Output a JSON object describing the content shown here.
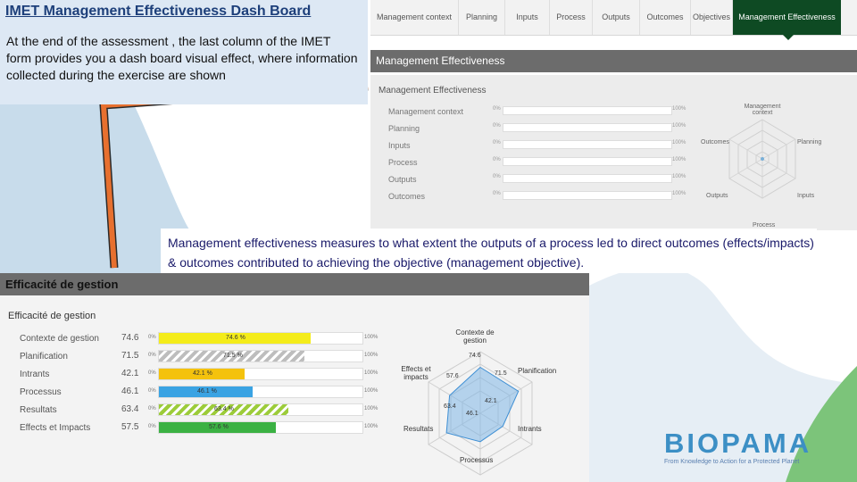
{
  "slide": {
    "title": "IMET Management Effectiveness Dash Board",
    "description": "At the end of the assessment , the last column of the IMET form provides you a dash board visual effect, where information collected during the exercise are shown",
    "definition": "Management effectiveness measures to what extent the outputs of a process led to direct outcomes (effects/impacts) & outcomes contributed to achieving the objective (management objective).",
    "colors": {
      "title_box": "#dde8f4",
      "arrow": "#e7702f",
      "active_tab": "#0e4a23"
    }
  },
  "en_panel": {
    "tabs": [
      "Management context",
      "Planning",
      "Inputs",
      "Process",
      "Outputs",
      "Outcomes",
      "Objectives",
      "Management Effectiveness"
    ],
    "active_tab": "Management Effectiveness",
    "header": "Management Effectiveness",
    "subheader": "Management Effectiveness",
    "rows": [
      "Management context",
      "Planning",
      "Inputs",
      "Process",
      "Outputs",
      "Outcomes"
    ],
    "zero_label": "0%",
    "hundred_label": "100%",
    "radar_labels": {
      "top": "Management context",
      "right_top": "Planning",
      "right_bottom": "Inputs",
      "bottom": "Process",
      "left_bottom": "Outputs",
      "left_top": "Outcomes"
    }
  },
  "fr_panel": {
    "header": "Efficacité de gestion",
    "subheader": "Efficacité de gestion",
    "zero_label": "0%",
    "hundred_label": "100%",
    "rows": [
      {
        "label": "Contexte de gestion",
        "value": "74.6",
        "pct": "74.6 %",
        "ratio": 0.746,
        "color": "#f4ec1a",
        "striped": false
      },
      {
        "label": "Planification",
        "value": "71.5",
        "pct": "71.5 %",
        "ratio": 0.715,
        "color": "#bdbdbd",
        "striped": true
      },
      {
        "label": "Intrants",
        "value": "42.1",
        "pct": "42.1 %",
        "ratio": 0.421,
        "color": "#f4c20d",
        "striped": false
      },
      {
        "label": "Processus",
        "value": "46.1",
        "pct": "46.1 %",
        "ratio": 0.461,
        "color": "#3aa3e3",
        "striped": false
      },
      {
        "label": "Resultats",
        "value": "63.4",
        "pct": "63.4 %",
        "ratio": 0.634,
        "color": "#9ccc3a",
        "striped": true
      },
      {
        "label": "Effects et Impacts",
        "value": "57.5",
        "pct": "57.6 %",
        "ratio": 0.575,
        "color": "#3bb143",
        "striped": false
      }
    ],
    "radar_labels": {
      "top": "Contexte de gestion",
      "right_top": "Planification",
      "right_bottom": "Intrants",
      "bottom": "Processus",
      "left_bottom": "Resultats",
      "left_top": "Effects et impacts"
    },
    "radar_values": {
      "top": "74.6",
      "right_top": "71.5",
      "right_bottom": "42.1",
      "bottom": "46.1",
      "left_bottom": "63.4",
      "left_top": "57.6"
    }
  },
  "logo": {
    "text": "BIOPAMA",
    "tagline": "From Knowledge to Action for a Protected Planet",
    "color": "#3c8fc5"
  }
}
